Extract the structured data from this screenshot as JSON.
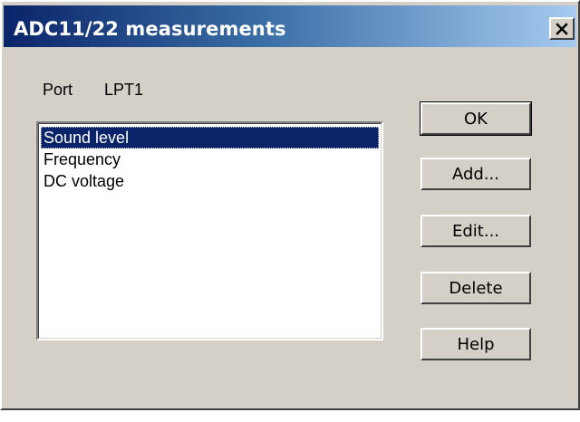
{
  "window": {
    "title": "ADC11/22 measurements"
  },
  "port": {
    "label": "Port",
    "value": "LPT1"
  },
  "measurements": {
    "items": [
      "Sound level",
      "Frequency",
      "DC voltage"
    ],
    "selected": "Sound level"
  },
  "buttons": {
    "ok": "OK",
    "add": "Add...",
    "edit": "Edit...",
    "delete": "Delete",
    "help": "Help"
  },
  "icons": {
    "close": "close-icon"
  },
  "colors": {
    "title_gradient_start": "#0a246a",
    "title_gradient_end": "#a6caf0",
    "face": "#d4d0c8",
    "selection": "#0a246a"
  }
}
